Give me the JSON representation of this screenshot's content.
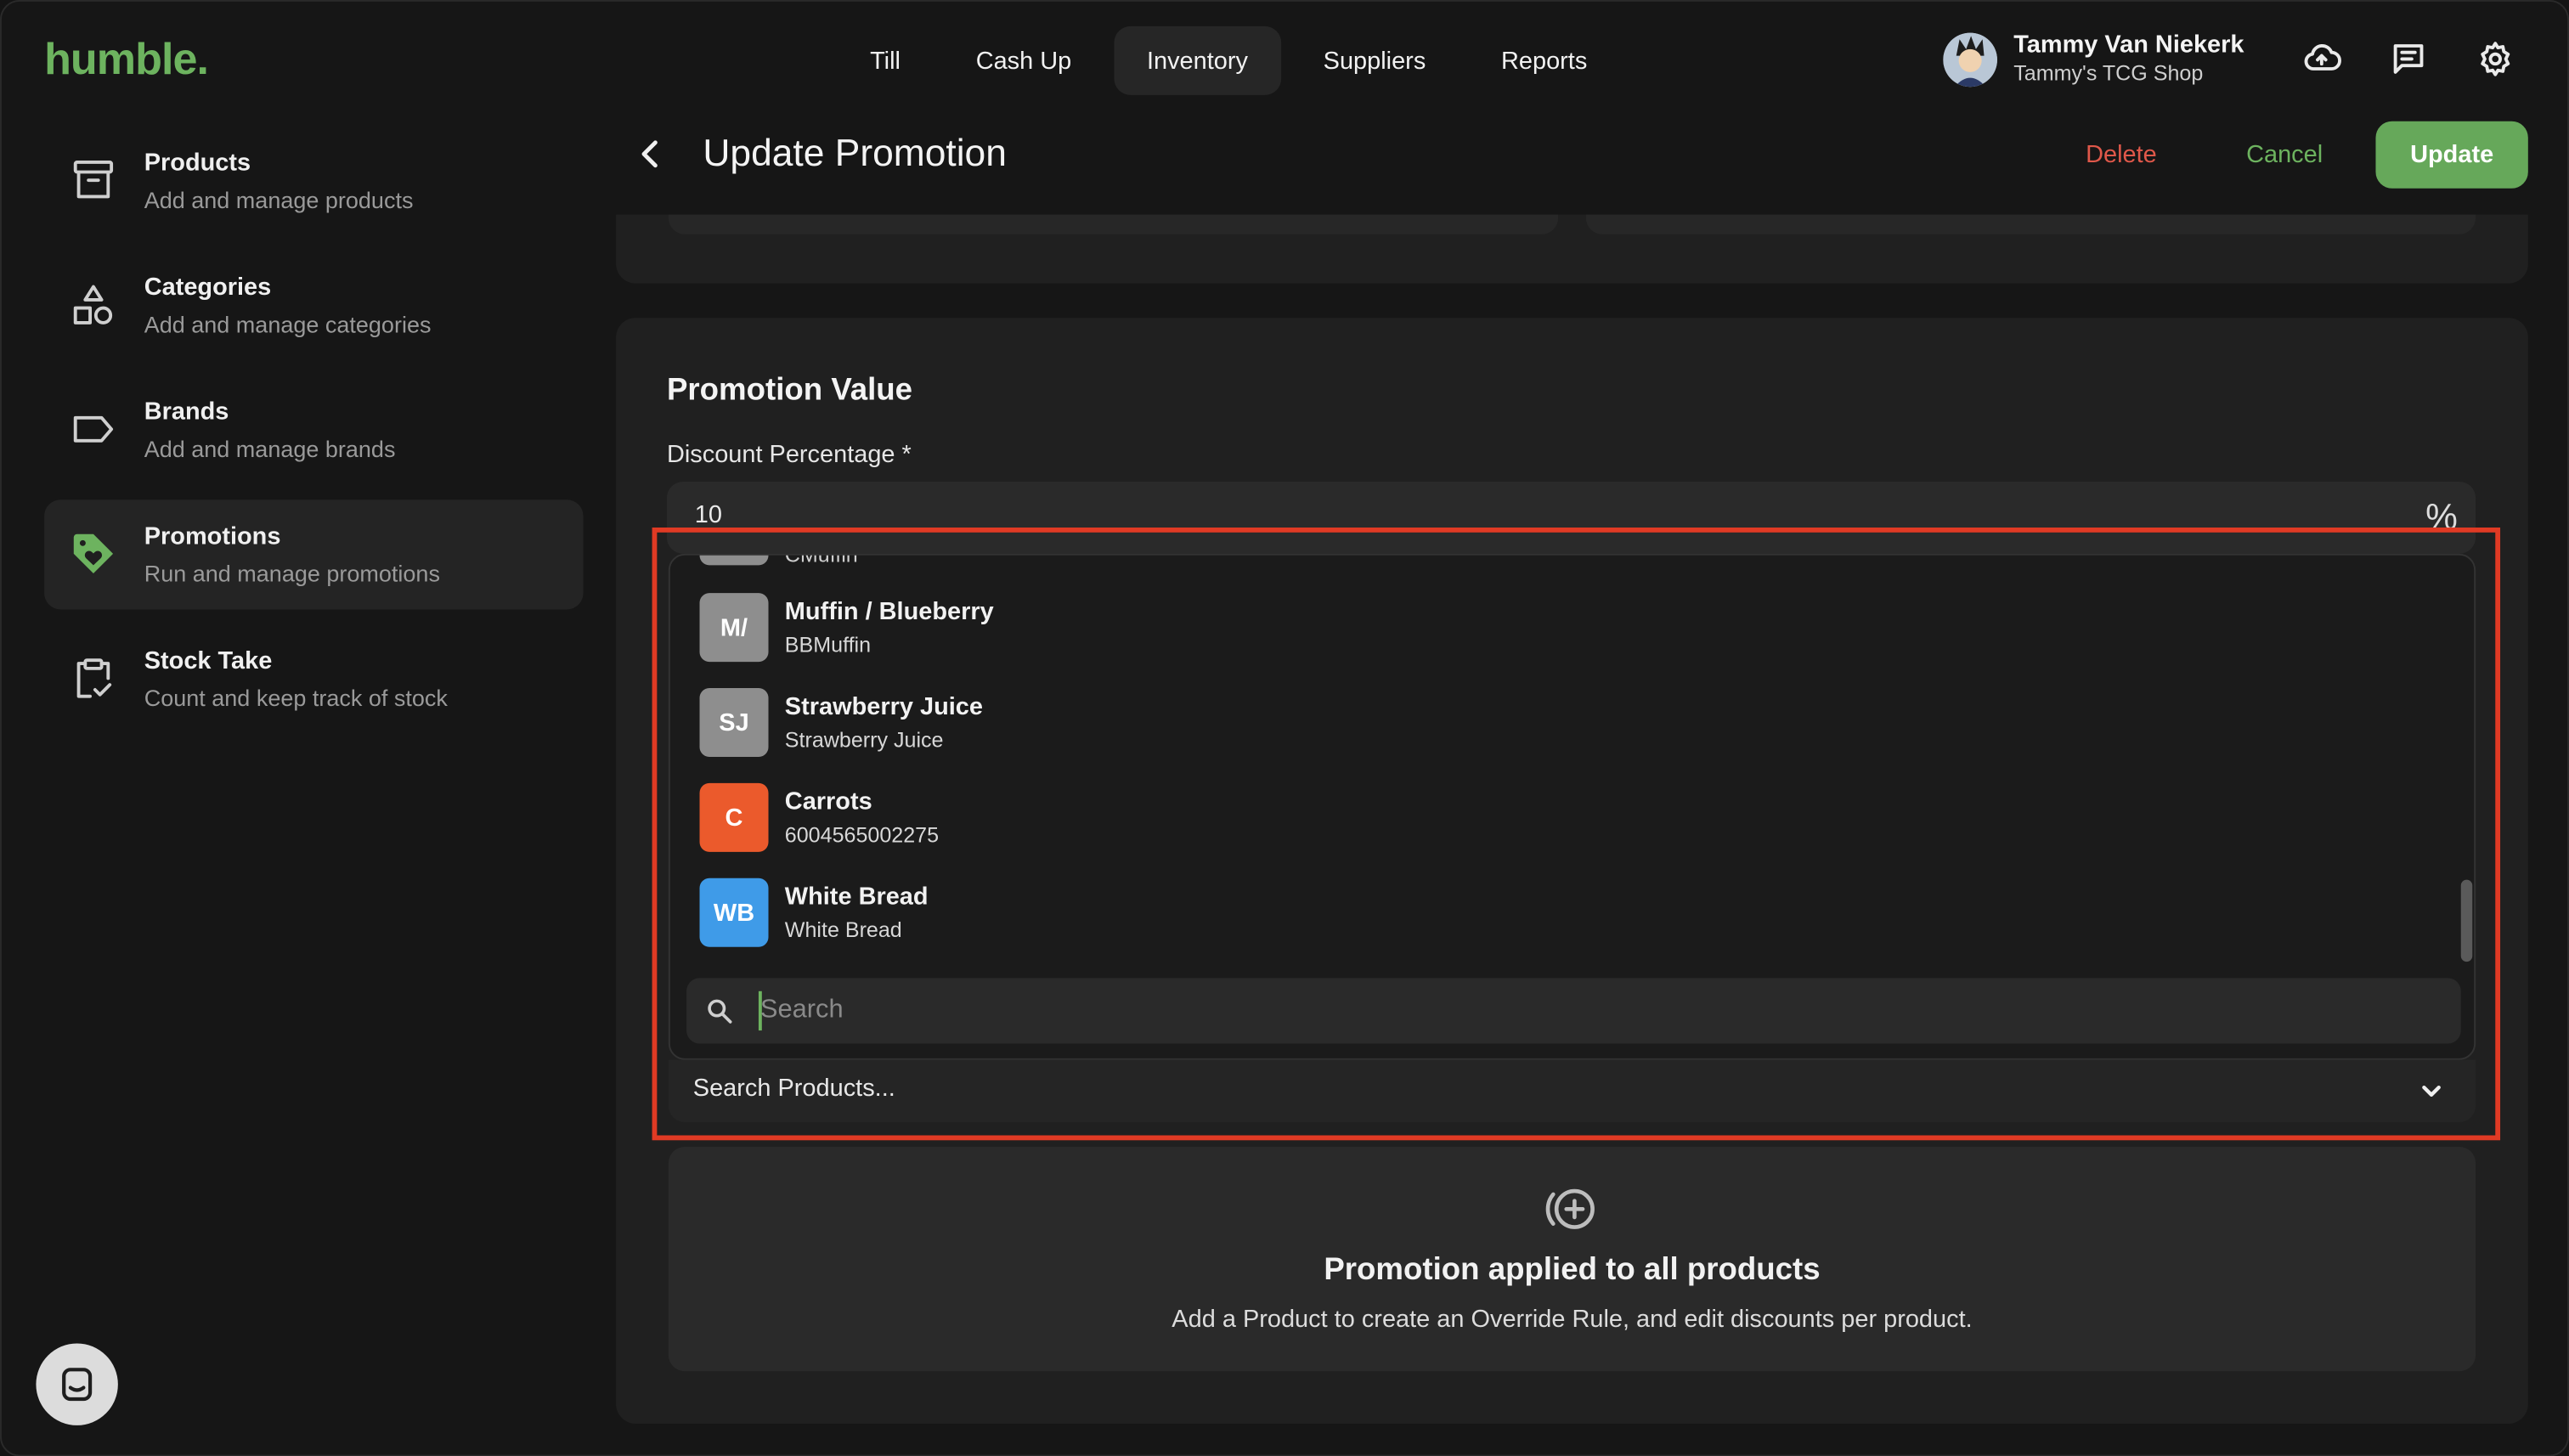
{
  "app": {
    "logo": "humble."
  },
  "topnav": {
    "tabs": [
      "Till",
      "Cash Up",
      "Inventory",
      "Suppliers",
      "Reports"
    ],
    "active": "Inventory"
  },
  "user": {
    "name": "Tammy Van Niekerk",
    "shop": "Tammy's TCG Shop"
  },
  "top_icons": [
    "cloud-upload-icon",
    "message-icon",
    "settings-gear-icon"
  ],
  "sidebar": {
    "items": [
      {
        "title": "Products",
        "subtitle": "Add and manage products",
        "icon": "archive-box-icon"
      },
      {
        "title": "Categories",
        "subtitle": "Add and manage categories",
        "icon": "shapes-icon"
      },
      {
        "title": "Brands",
        "subtitle": "Add and manage brands",
        "icon": "tag-outline-icon"
      },
      {
        "title": "Promotions",
        "subtitle": "Run and manage promotions",
        "icon": "promo-tag-icon"
      },
      {
        "title": "Stock Take",
        "subtitle": "Count and keep track of stock",
        "icon": "clipboard-check-icon"
      }
    ],
    "active": "Promotions"
  },
  "header": {
    "title": "Update Promotion",
    "delete": "Delete",
    "cancel": "Cancel",
    "update": "Update"
  },
  "promotion": {
    "section_title": "Promotion Value",
    "discount_label": "Discount Percentage *",
    "discount_value": "10",
    "unit": "%"
  },
  "dropdown": {
    "partial_item_sub": "CMuffin",
    "items": [
      {
        "initials": "M/",
        "name": "Muffin / Blueberry",
        "sub": "BBMuffin",
        "color": "#8e8e8e"
      },
      {
        "initials": "SJ",
        "name": "Strawberry Juice",
        "sub": "Strawberry Juice",
        "color": "#8e8e8e"
      },
      {
        "initials": "C",
        "name": "Carrots",
        "sub": "6004565002275",
        "color": "#eb5a2c"
      },
      {
        "initials": "WB",
        "name": "White Bread",
        "sub": "White Bread",
        "color": "#3f9be8"
      }
    ],
    "search_placeholder": "Search",
    "search_value": ""
  },
  "product_select": {
    "placeholder": "Search Products..."
  },
  "empty_state": {
    "title": "Promotion applied to all products",
    "subtitle": "Add a Product to create an Override Rule, and edit discounts per product."
  },
  "colors": {
    "brand": "#6db35f",
    "danger": "#e0584a",
    "highlight": "#e03a24"
  }
}
